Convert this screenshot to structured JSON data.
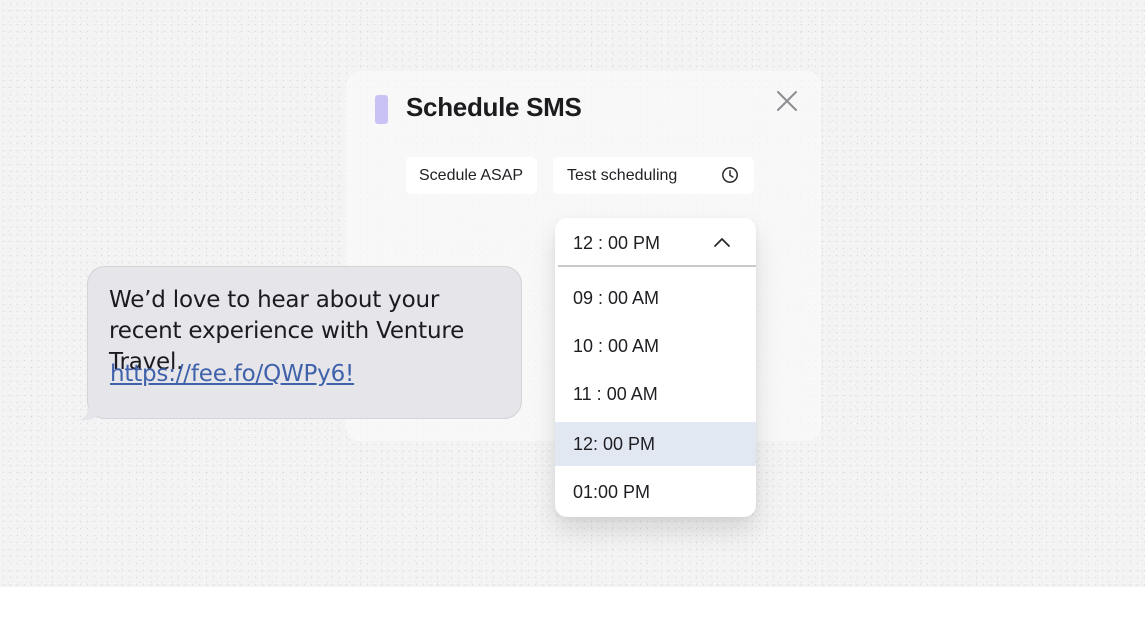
{
  "dialog": {
    "title": "Schedule SMS",
    "accent_color": "#c8c2f5",
    "close_icon": "close-icon"
  },
  "scheduling": {
    "asap_label": "Scedule ASAP",
    "test_label": "Test scheduling",
    "test_icon": "clock-icon"
  },
  "time_dropdown": {
    "selected_value": "12 : 00 PM",
    "expanded": true,
    "chevron_icon": "chevron-up-icon",
    "options": [
      {
        "label": "09 : 00 AM",
        "selected": false
      },
      {
        "label": "10 : 00 AM",
        "selected": false
      },
      {
        "label": "11 : 00 AM",
        "selected": false
      },
      {
        "label": "12: 00 PM",
        "selected": true
      },
      {
        "label": "01:00 PM",
        "selected": false
      }
    ],
    "highlight_color": "#e2e8f1"
  },
  "sms_preview": {
    "message": "We’d love to hear about your recent experience with Venture Travel.",
    "link": "https://fee.fo/QWPy6!",
    "bubble_color": "#e5e5ea",
    "link_color": "#3f62aa"
  }
}
